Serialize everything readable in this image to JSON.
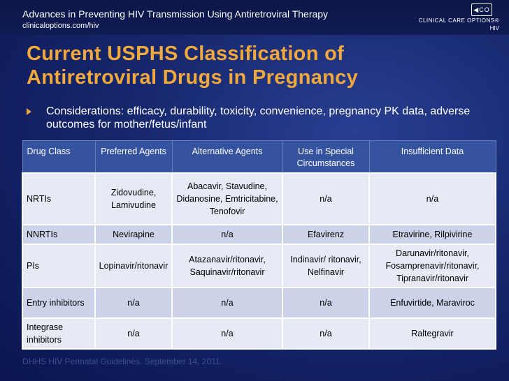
{
  "header": {
    "title": "Advances in Preventing HIV Transmission Using Antiretroviral Therapy",
    "url": "clinicaloptions.com/hiv"
  },
  "logo": {
    "line1": "CLINICAL CARE OPTIONS®",
    "line2": "HIV"
  },
  "slide": {
    "title": "Current USPHS Classification of Antiretroviral Drugs in Pregnancy",
    "bullet": "Considerations: efficacy, durability, toxicity, convenience, pregnancy PK data, adverse outcomes for mother/fetus/infant"
  },
  "table": {
    "headers": [
      "Drug Class",
      "Preferred Agents",
      "Alternative Agents",
      "Use in Special Circumstances",
      "Insufficient Data"
    ],
    "rows": [
      [
        "NRTIs",
        "Zidovudine, Lamivudine",
        "Abacavir, Stavudine, Didanosine, Emtricitabine, Tenofovir",
        "n/a",
        "n/a"
      ],
      [
        "NNRTIs",
        "Nevirapine",
        "n/a",
        "Efavirenz",
        "Etravirine, Rilpivirine"
      ],
      [
        "PIs",
        "Lopinavir/ritonavir",
        "Atazanavir/ritonavir, Saquinavir/ritonavir",
        "Indinavir/ ritonavir, Nelfinavir",
        "Darunavir/ritonavir, Fosamprenavir/ritonavir, Tipranavir/ritonavir"
      ],
      [
        "Entry inhibitors",
        "n/a",
        "n/a",
        "n/a",
        "Enfuvirtide, Maraviroc"
      ],
      [
        "Integrase inhibitors",
        "n/a",
        "n/a",
        "n/a",
        "Raltegravir"
      ]
    ]
  },
  "source": "DHHS HIV Perinatal Guidelines. September 14, 2011."
}
